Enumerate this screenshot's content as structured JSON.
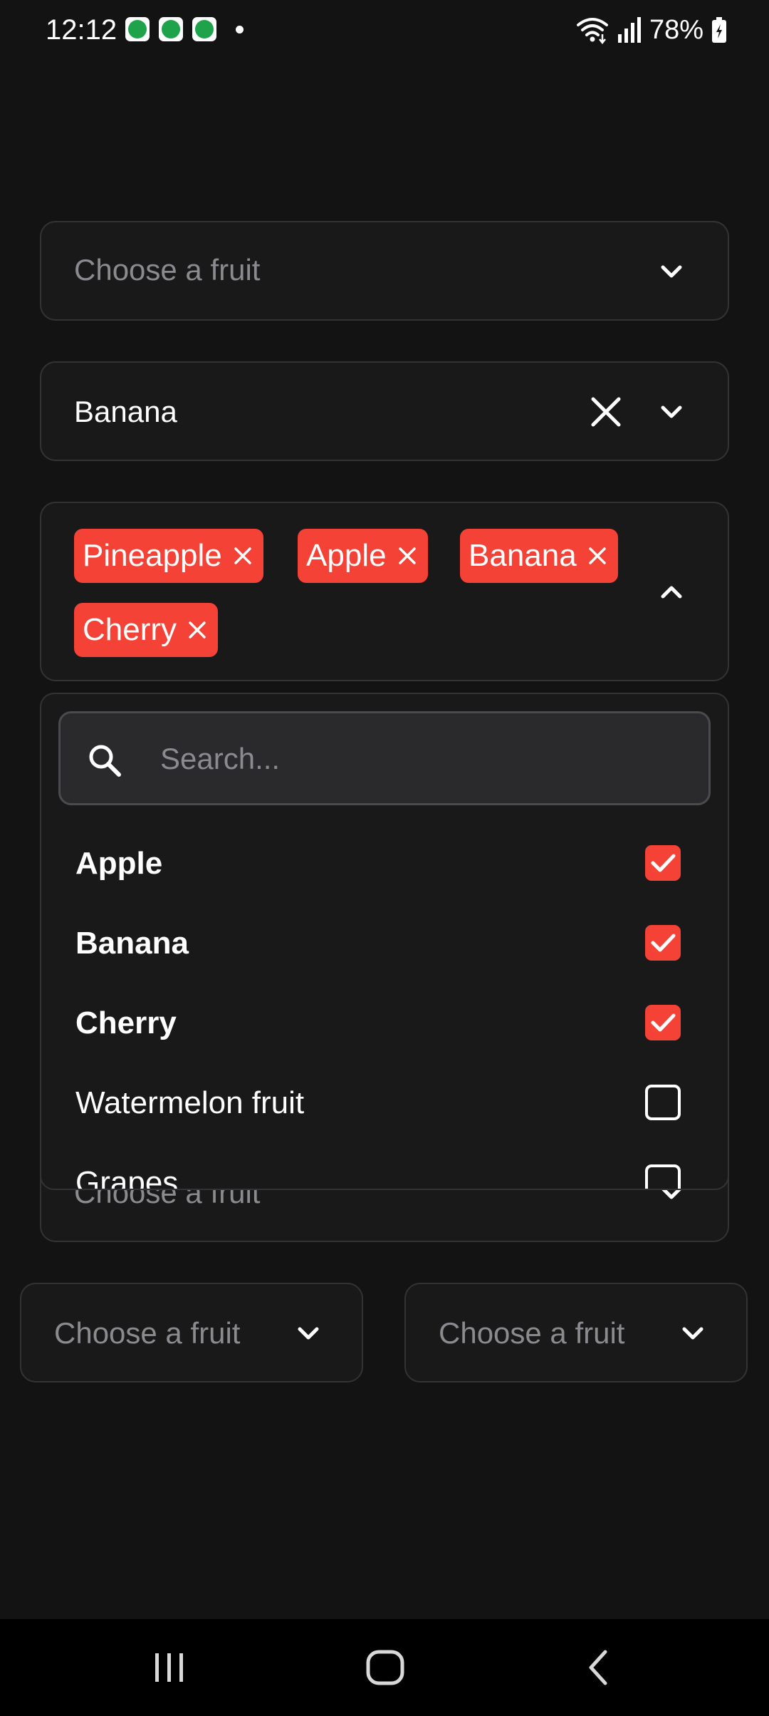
{
  "status_bar": {
    "time": "12:12",
    "notification_icons": [
      "w8-app-icon",
      "w8-app-icon",
      "w8-app-icon"
    ],
    "battery": "78%"
  },
  "dropdowns": {
    "basic": {
      "placeholder": "Choose a fruit"
    },
    "single_selected": {
      "value": "Banana"
    },
    "multi": {
      "chips": [
        {
          "label": "Pineapple"
        },
        {
          "label": "Apple"
        },
        {
          "label": "Banana"
        },
        {
          "label": "Cherry"
        }
      ]
    },
    "underlying": {
      "placeholder": "Choose a fruit"
    },
    "left_small": {
      "placeholder": "Choose a fruit"
    },
    "right_small": {
      "placeholder": "Choose a fruit"
    }
  },
  "popup": {
    "search_placeholder": "Search...",
    "options": [
      {
        "label": "Apple",
        "checked": true
      },
      {
        "label": "Banana",
        "checked": true
      },
      {
        "label": "Cherry",
        "checked": true
      },
      {
        "label": "Watermelon fruit",
        "checked": false
      },
      {
        "label": "Grapes",
        "checked": false
      }
    ]
  },
  "colors": {
    "accent": "#f44336",
    "background": "#131314",
    "field_background": "#19191a",
    "border": "#333336",
    "placeholder": "#8b8b8f"
  }
}
